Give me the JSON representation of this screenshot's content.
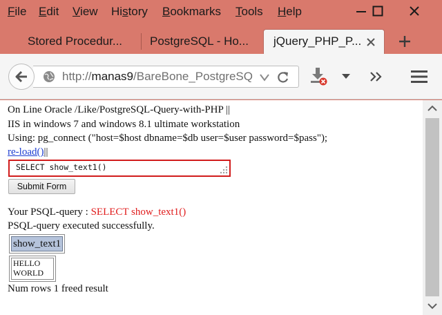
{
  "menu": {
    "items": [
      {
        "accel": "F",
        "rest": "ile"
      },
      {
        "accel": "E",
        "rest": "dit"
      },
      {
        "accel": "V",
        "rest": "iew"
      },
      {
        "pre": "Hi",
        "accel": "s",
        "rest": "tory"
      },
      {
        "accel": "B",
        "rest": "ookmarks"
      },
      {
        "accel": "T",
        "rest": "ools"
      },
      {
        "accel": "H",
        "rest": "elp"
      }
    ]
  },
  "tabs": [
    {
      "label": "Stored Procedur...",
      "active": false
    },
    {
      "label": "PostgreSQL - Ho...",
      "active": false
    },
    {
      "label": "jQuery_PHP_P...",
      "active": true
    }
  ],
  "address": {
    "scheme": "http://",
    "host": "manas9",
    "path": "/BareBone_PostgreSQ"
  },
  "page": {
    "line1": "On Line Oracle /Like/PostgreSQL-Query-with-PHP ||",
    "line2": "IIS in windows 7 and windows 8.1 ultimate workstation",
    "line3": "Using: pg_connect (\"host=$host dbname=$db user=$user password=$pass\");",
    "reload_link": "re-load()",
    "reload_suffix": "||",
    "query_value": "SELECT show_text1()",
    "submit_label": "Submit Form",
    "your_query_label": "Your PSQL-query : ",
    "your_query_value": "SELECT show_text1()",
    "exec_status": "PSQL-query executed successfully.",
    "table_header": "show_text1",
    "table_cell_line1": "HELLO",
    "table_cell_line2": "WORLD",
    "num_rows": "Num rows 1 freed result"
  },
  "colors": {
    "chrome": "#d9796c",
    "query_border": "#d11b1b",
    "link": "#1a3bd1",
    "red_text": "#e01b1b",
    "table_header_bg": "#b5c3db"
  },
  "icons": [
    "minimize-icon",
    "maximize-icon",
    "close-icon",
    "tab-close-icon",
    "new-tab-icon",
    "back-arrow-icon",
    "globe-icon",
    "dropdown-arrow-icon",
    "reload-icon",
    "download-icon",
    "overflow-chevron-icon",
    "hamburger-menu-icon",
    "scroll-up-icon",
    "scroll-down-icon",
    "resize-grip-icon"
  ]
}
